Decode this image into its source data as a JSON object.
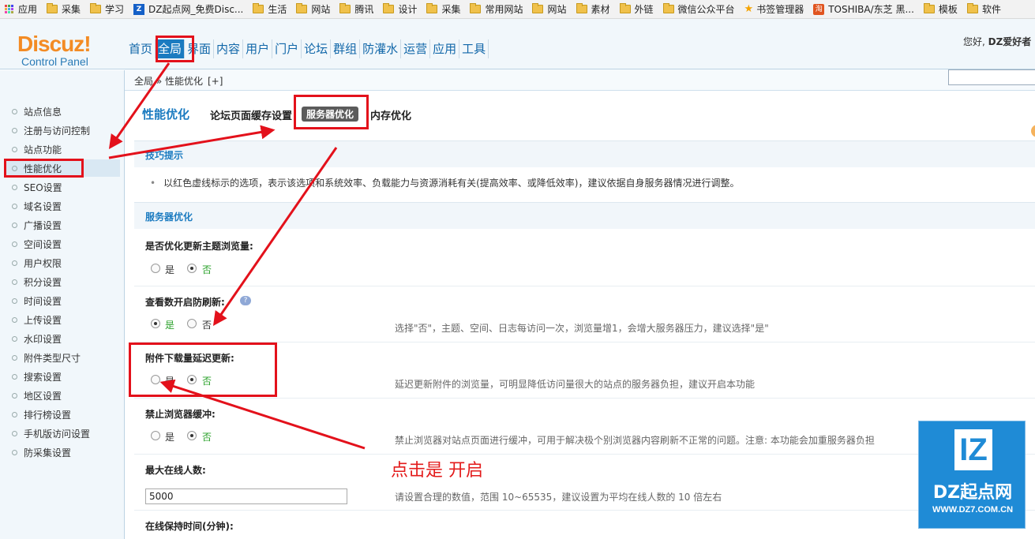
{
  "bookmarks": [
    {
      "label": "应用",
      "icon": "apps-icon"
    },
    {
      "label": "采集",
      "icon": "folder-icon"
    },
    {
      "label": "学习",
      "icon": "folder-icon"
    },
    {
      "label": "DZ起点网_免费Disc...",
      "icon": "dz-site-icon"
    },
    {
      "label": "生活",
      "icon": "folder-icon"
    },
    {
      "label": "网站",
      "icon": "folder-icon"
    },
    {
      "label": "腾讯",
      "icon": "folder-icon"
    },
    {
      "label": "设计",
      "icon": "folder-icon"
    },
    {
      "label": "采集",
      "icon": "folder-icon"
    },
    {
      "label": "常用网站",
      "icon": "folder-icon"
    },
    {
      "label": "网站",
      "icon": "folder-icon"
    },
    {
      "label": "素材",
      "icon": "folder-icon"
    },
    {
      "label": "外链",
      "icon": "folder-icon"
    },
    {
      "label": "微信公众平台",
      "icon": "folder-icon"
    },
    {
      "label": "书签管理器",
      "icon": "star-icon"
    },
    {
      "label": "TOSHIBA/东芝 黑...",
      "icon": "taobao-icon"
    },
    {
      "label": "模板",
      "icon": "folder-icon"
    },
    {
      "label": "软件",
      "icon": "folder-icon"
    }
  ],
  "logo": {
    "brand": "Discuz!",
    "sub": "Control Panel"
  },
  "topnav": [
    "首页",
    "全局",
    "界面",
    "内容",
    "用户",
    "门户",
    "论坛",
    "群组",
    "防灌水",
    "运营",
    "应用",
    "工具"
  ],
  "greeting": {
    "prefix": "您好, ",
    "user": "DZ爱好者"
  },
  "breadcrumb": {
    "path": "全局 » 性能优化",
    "add": "[+]"
  },
  "sidebar": [
    "站点信息",
    "注册与访问控制",
    "站点功能",
    "性能优化",
    "SEO设置",
    "域名设置",
    "广播设置",
    "空间设置",
    "用户权限",
    "积分设置",
    "时间设置",
    "上传设置",
    "水印设置",
    "附件类型尺寸",
    "搜索设置",
    "地区设置",
    "排行榜设置",
    "手机版访问设置",
    "防采集设置"
  ],
  "page": {
    "title": "性能优化",
    "tabs": [
      "论坛页面缓存设置",
      "服务器优化",
      "内存优化"
    ]
  },
  "tips": {
    "heading": "技巧提示",
    "text": "以红色虚线标示的选项，表示该选项和系统效率、负载能力与资源消耗有关(提高效率、或降低效率)，建议依据自身服务器情况进行调整。"
  },
  "server_section": "服务器优化",
  "settings": [
    {
      "label": "是否优化更新主题浏览量:",
      "yes": "是",
      "no": "否",
      "selected": "否",
      "hint": ""
    },
    {
      "label": "查看数开启防刷新:",
      "yes": "是",
      "no": "否",
      "selected": "是",
      "hint": "选择\"否\"，主题、空间、日志每访问一次，浏览量增1，会增大服务器压力，建议选择\"是\""
    },
    {
      "label": "附件下载量延迟更新:",
      "yes": "是",
      "no": "否",
      "selected": "否",
      "hint": "延迟更新附件的浏览量，可明显降低访问量很大的站点的服务器负担，建议开启本功能"
    },
    {
      "label": "禁止浏览器缓冲:",
      "yes": "是",
      "no": "否",
      "selected": "否",
      "hint": "禁止浏览器对站点页面进行缓冲，可用于解决极个别浏览器内容刷新不正常的问题。注意: 本功能会加重服务器负担"
    }
  ],
  "max_online": {
    "label": "最大在线人数:",
    "value": "5000",
    "hint": "请设置合理的数值，范围 10~65535，建议设置为平均在线人数的 10 倍左右"
  },
  "online_time": {
    "label": "在线保持时间(分钟):"
  },
  "annotation": {
    "note": "点击是  开启",
    "color": "#e3111b"
  },
  "watermark": {
    "mark": "IZ",
    "name": "DZ起点网",
    "url": "WWW.DZ7.COM.CN"
  }
}
